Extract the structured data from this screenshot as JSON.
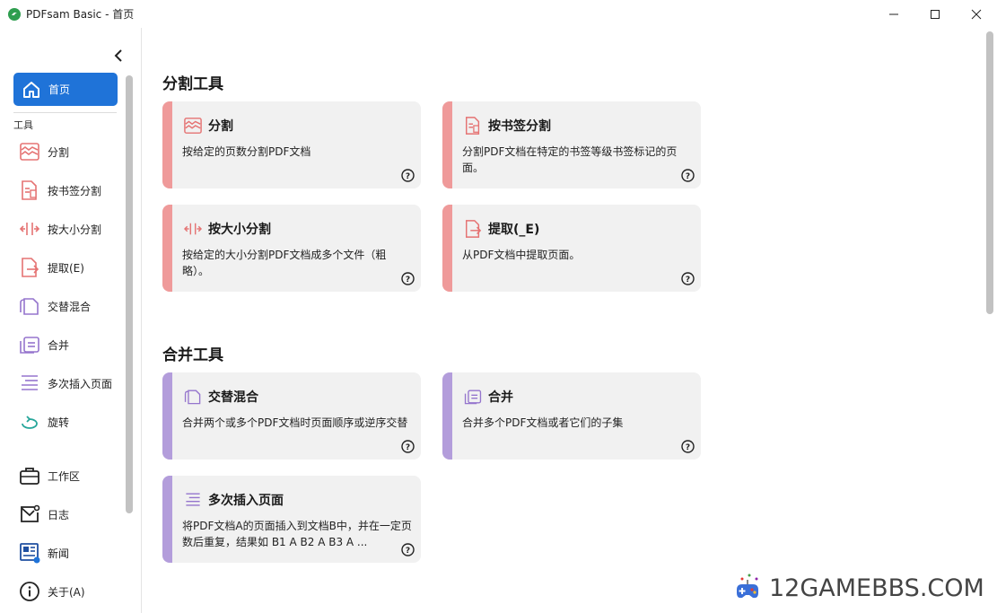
{
  "window": {
    "title": "PDFsam Basic - 首页",
    "controls": [
      "minimize-icon",
      "maximize-icon",
      "close-icon"
    ]
  },
  "sidebar": {
    "home_label": "首页",
    "tools_section": "工具",
    "tools": [
      {
        "label": "分割",
        "icon": "split-icon"
      },
      {
        "label": "按书签分割",
        "icon": "bookmark-split-icon"
      },
      {
        "label": "按大小分割",
        "icon": "size-split-icon"
      },
      {
        "label": "提取(E)",
        "icon": "extract-icon"
      },
      {
        "label": "交替混合",
        "icon": "alternate-mix-icon"
      },
      {
        "label": "合并",
        "icon": "merge-icon"
      },
      {
        "label": "多次插入页面",
        "icon": "insert-pages-icon"
      },
      {
        "label": "旋转",
        "icon": "rotate-icon"
      }
    ],
    "bottom": [
      {
        "label": "工作区",
        "icon": "briefcase-icon"
      },
      {
        "label": "日志",
        "icon": "log-icon"
      },
      {
        "label": "新闻",
        "icon": "news-icon"
      },
      {
        "label": "关于(A)",
        "icon": "info-icon"
      }
    ]
  },
  "main": {
    "split_section_title": "分割工具",
    "merge_section_title": "合并工具",
    "split_cards": [
      {
        "title": "分割",
        "desc": "按给定的页数分割PDF文档",
        "icon": "split-icon"
      },
      {
        "title": "按书签分割",
        "desc": "分割PDF文档在特定的书签等级书签标记的页面。",
        "icon": "bookmark-split-icon"
      },
      {
        "title": "按大小分割",
        "desc": "按给定的大小分割PDF文档成多个文件（粗略）。",
        "icon": "size-split-icon"
      },
      {
        "title": "提取(_E)",
        "desc": "从PDF文档中提取页面。",
        "icon": "extract-icon"
      }
    ],
    "merge_cards": [
      {
        "title": "交替混合",
        "desc": "合并两个或多个PDF文档时页面顺序或逆序交替",
        "icon": "alternate-mix-icon"
      },
      {
        "title": "合并",
        "desc": "合并多个PDF文档或者它们的子集",
        "icon": "merge-icon"
      },
      {
        "title": "多次插入页面",
        "desc": "将PDF文档A的页面插入到文档B中，并在一定页数后重复，结果如 B1 A B2 A B3 A ...",
        "icon": "insert-pages-icon"
      }
    ]
  },
  "watermark": {
    "text": "12GAMEBBS.COM"
  },
  "colors": {
    "accent": "#1f73d8",
    "split_bar": "#ef9a9a",
    "merge_bar": "#b39ddb",
    "card_bg": "#f1f1f1",
    "icon_red": "#e57373",
    "icon_purple": "#9575cd",
    "icon_teal": "#26a69a"
  }
}
